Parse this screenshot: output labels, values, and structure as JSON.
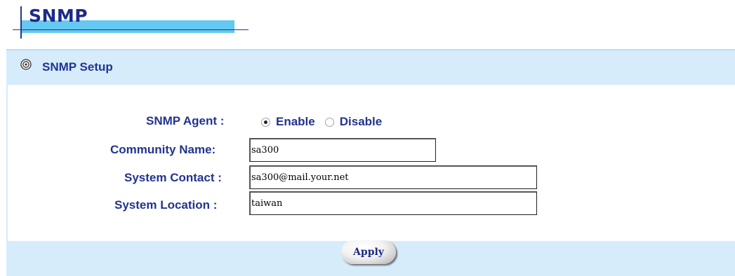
{
  "page": {
    "title": "SNMP"
  },
  "panel": {
    "title": "SNMP Setup",
    "icon": "gear-circle-icon"
  },
  "form": {
    "agent_label": "SNMP Agent :",
    "agent_options": [
      {
        "label": "Enable",
        "checked": true
      },
      {
        "label": "Disable",
        "checked": false
      }
    ],
    "community_label": "Community Name:",
    "community_value": "sa300",
    "contact_label": "System Contact :",
    "contact_value": "sa300@mail.your.net",
    "location_label": "System Location :",
    "location_value": "taiwan"
  },
  "actions": {
    "apply_label": "Apply"
  },
  "colors": {
    "header_accent": "#64c8f0",
    "panel_bg": "#d6ecfb",
    "label_text": "#22338f"
  }
}
